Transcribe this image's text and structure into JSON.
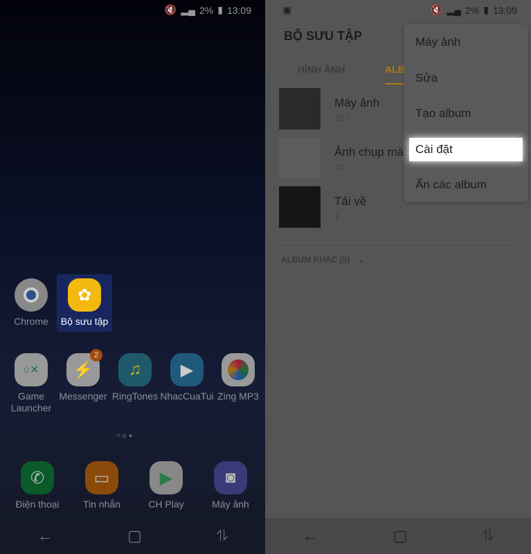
{
  "left": {
    "status": {
      "battery": "2%",
      "time": "13:09"
    },
    "row1": [
      {
        "label": "Chrome",
        "icon": "chrome-icon"
      },
      {
        "label": "Bộ sưu tập",
        "icon": "gallery-flower-icon",
        "highlighted": true
      }
    ],
    "row2": [
      {
        "label": "Game Launcher",
        "icon": "game-launcher-icon"
      },
      {
        "label": "Messenger",
        "icon": "messenger-icon",
        "badge": "2"
      },
      {
        "label": "RingTones",
        "icon": "music-note-icon"
      },
      {
        "label": "NhacCuaTui",
        "icon": "play-icon"
      },
      {
        "label": "Zing MP3",
        "icon": "zing-icon"
      }
    ],
    "dock": [
      {
        "label": "Điện thoại",
        "icon": "phone-icon",
        "color": "#0a5a2a"
      },
      {
        "label": "Tin nhắn",
        "icon": "message-icon",
        "color": "#8a4a0a"
      },
      {
        "label": "CH Play",
        "icon": "play-store-icon",
        "color": "#888888"
      },
      {
        "label": "Máy ảnh",
        "icon": "camera-icon",
        "color": "#3a3a7a"
      }
    ]
  },
  "right": {
    "status": {
      "battery": "2%",
      "time": "13:09"
    },
    "title": "BỘ SƯU TẬP",
    "tabs": [
      "HÌNH ẢNH",
      "ALBUM"
    ],
    "accent": "#b07a10",
    "albums": [
      {
        "name": "Máy ảnh",
        "count": "257"
      },
      {
        "name": "Ảnh chụp màn hình",
        "count": "70"
      },
      {
        "name": "Tải về",
        "count": "1"
      }
    ],
    "other": "ALBUM KHÁC (5)",
    "menu": [
      "Máy ảnh",
      "Sửa",
      "Tạo album",
      "Cài đặt",
      "Ẩn các album"
    ],
    "selected_menu": "Cài đặt"
  }
}
